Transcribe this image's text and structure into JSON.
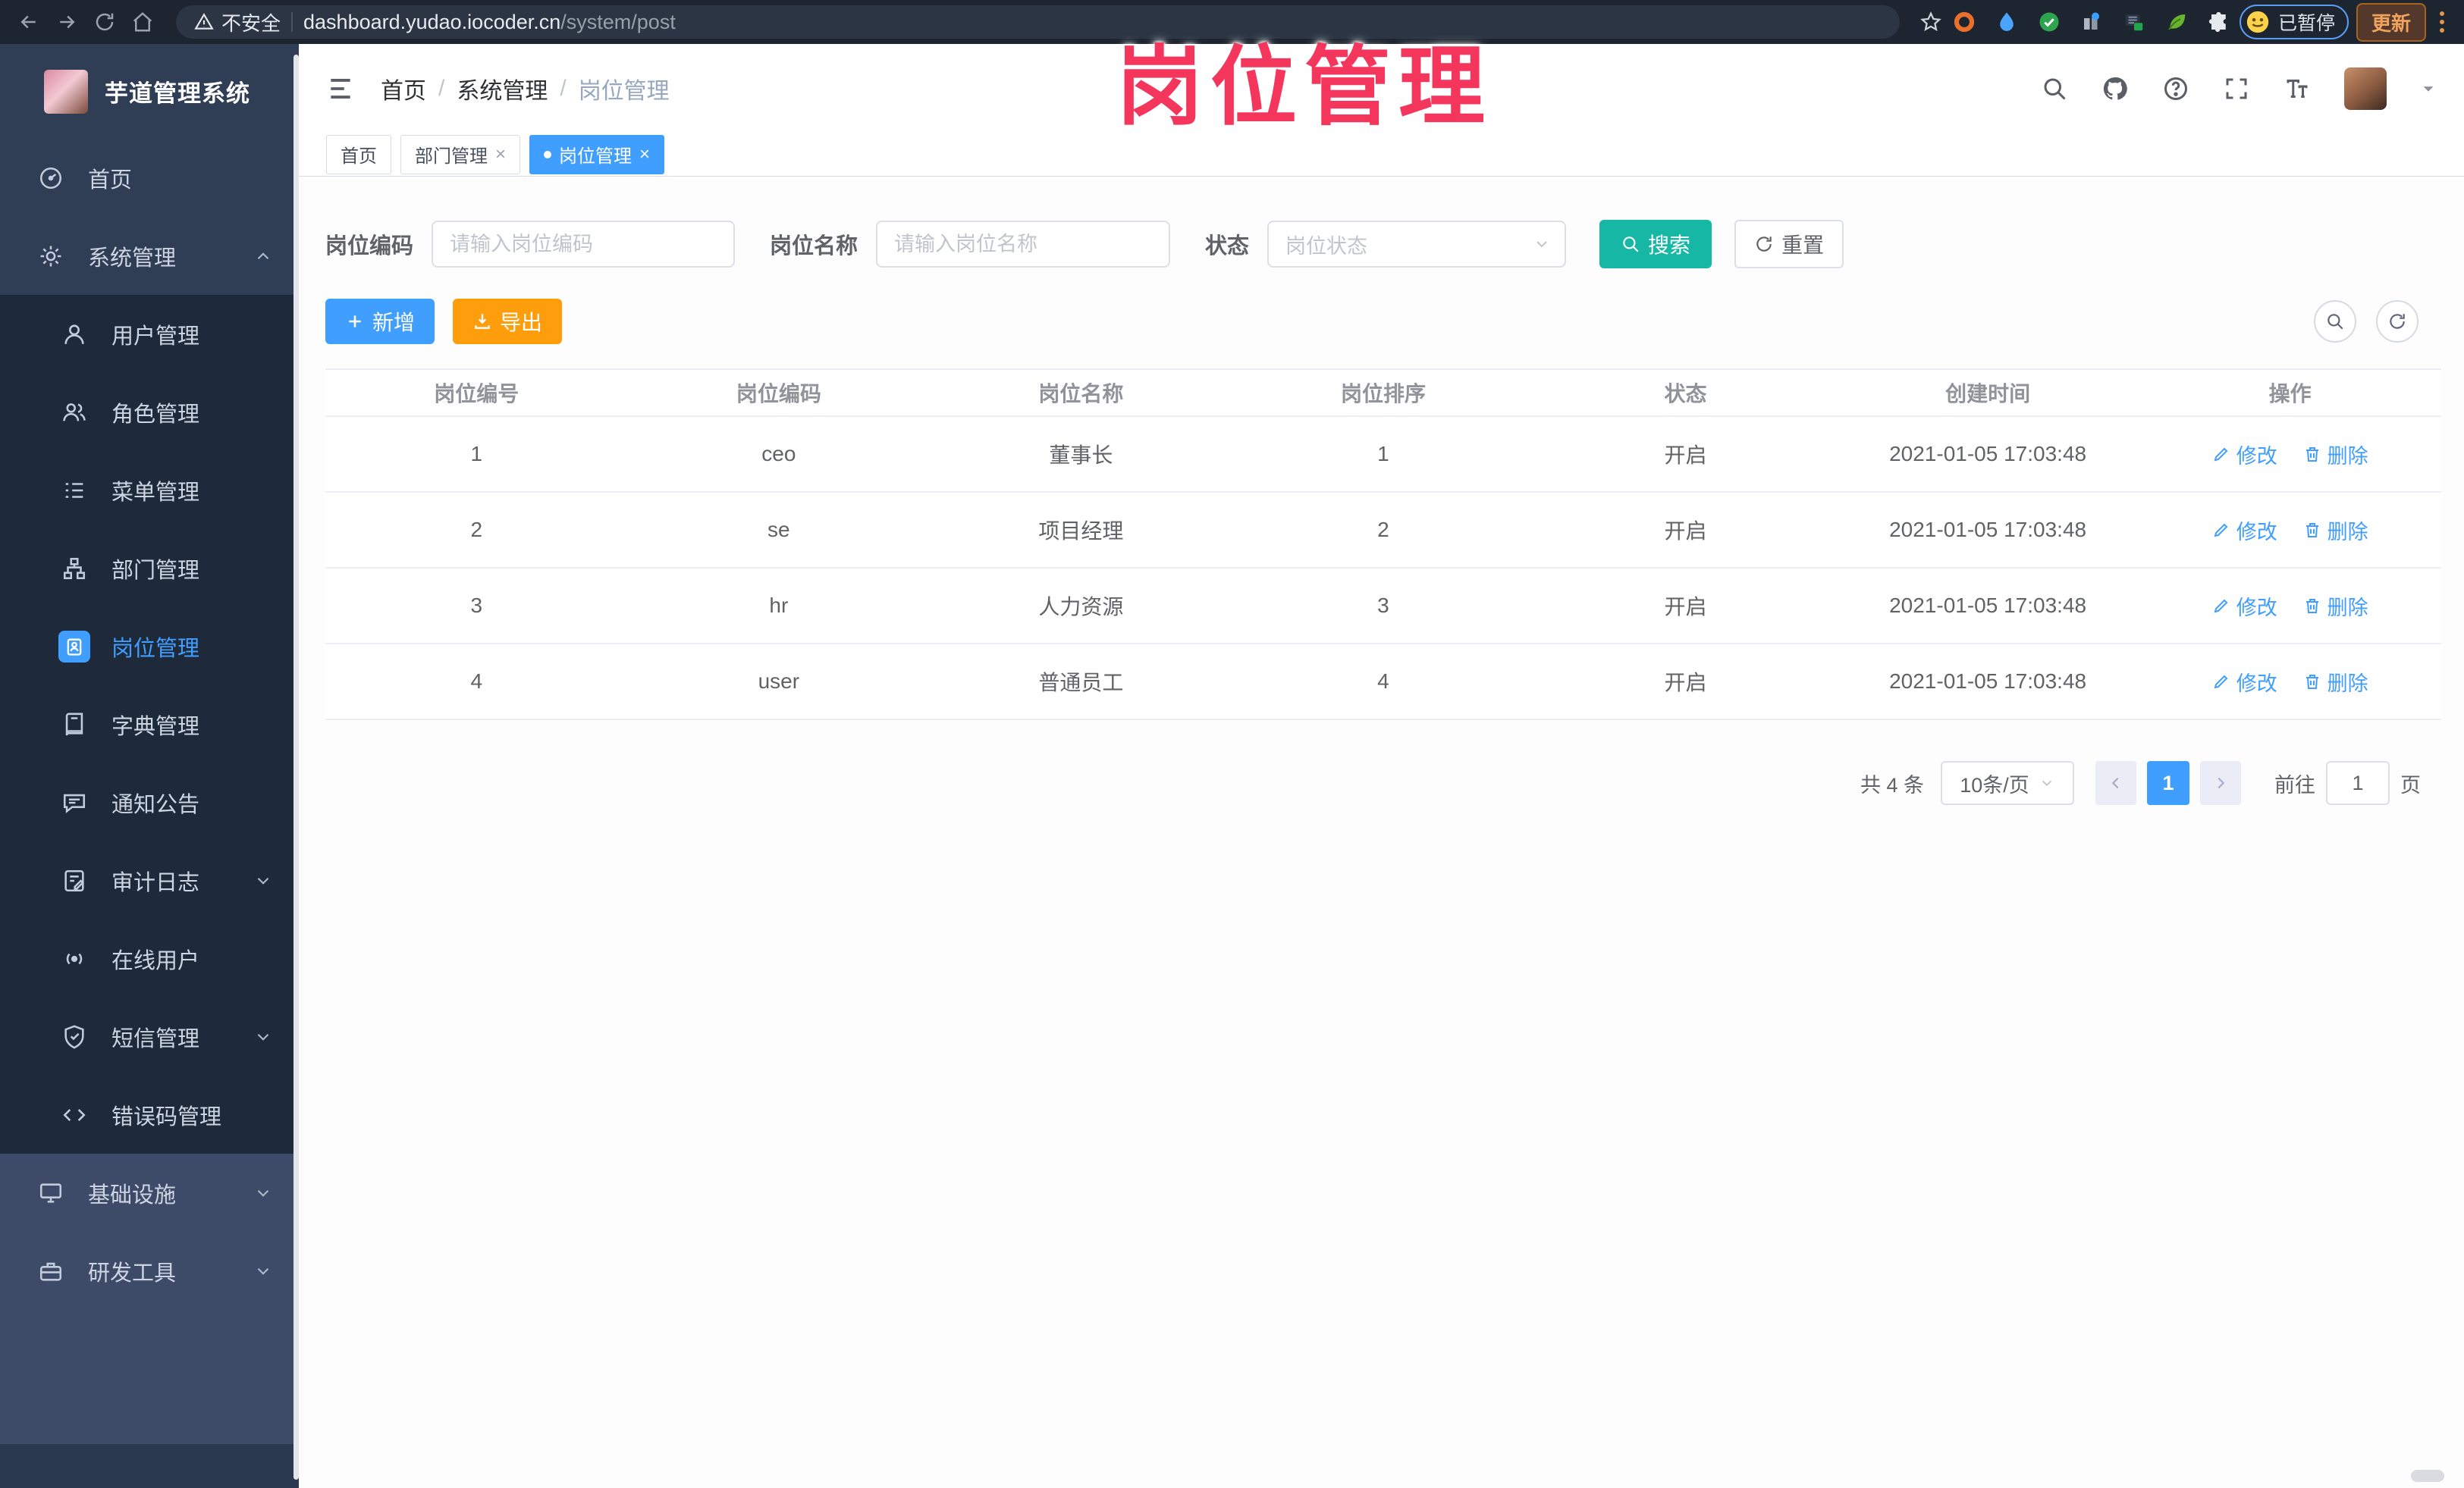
{
  "watermark": {
    "text": "岗位管理"
  },
  "browser": {
    "security_label": "不安全",
    "url_domain": "dashboard.yudao.iocoder.cn",
    "url_path": "/system/post",
    "paused_label": "已暂停",
    "update_label": "更新"
  },
  "sidebar": {
    "title": "芋道管理系统",
    "items": [
      {
        "label": "首页"
      },
      {
        "label": "系统管理"
      },
      {
        "label": "用户管理"
      },
      {
        "label": "角色管理"
      },
      {
        "label": "菜单管理"
      },
      {
        "label": "部门管理"
      },
      {
        "label": "岗位管理"
      },
      {
        "label": "字典管理"
      },
      {
        "label": "通知公告"
      },
      {
        "label": "审计日志"
      },
      {
        "label": "在线用户"
      },
      {
        "label": "短信管理"
      },
      {
        "label": "错误码管理"
      },
      {
        "label": "基础设施"
      },
      {
        "label": "研发工具"
      }
    ]
  },
  "header": {
    "breadcrumb": [
      "首页",
      "系统管理",
      "岗位管理"
    ],
    "separator": "/"
  },
  "tabs": [
    {
      "label": "首页"
    },
    {
      "label": "部门管理"
    },
    {
      "label": "岗位管理"
    }
  ],
  "filters": {
    "code_label": "岗位编码",
    "code_placeholder": "请输入岗位编码",
    "name_label": "岗位名称",
    "name_placeholder": "请输入岗位名称",
    "status_label": "状态",
    "status_placeholder": "岗位状态",
    "search_label": "搜索",
    "reset_label": "重置"
  },
  "toolbar": {
    "add_label": "新增",
    "export_label": "导出"
  },
  "table": {
    "columns": [
      "岗位编号",
      "岗位编码",
      "岗位名称",
      "岗位排序",
      "状态",
      "创建时间",
      "操作"
    ],
    "rows": [
      [
        "1",
        "ceo",
        "董事长",
        "1",
        "开启",
        "2021-01-05 17:03:48"
      ],
      [
        "2",
        "se",
        "项目经理",
        "2",
        "开启",
        "2021-01-05 17:03:48"
      ],
      [
        "3",
        "hr",
        "人力资源",
        "3",
        "开启",
        "2021-01-05 17:03:48"
      ],
      [
        "4",
        "user",
        "普通员工",
        "4",
        "开启",
        "2021-01-05 17:03:48"
      ]
    ],
    "edit_label": "修改",
    "delete_label": "删除"
  },
  "pagination": {
    "total_label": "共 4 条",
    "page_size_label": "10条/页",
    "current_page": "1",
    "goto_label": "前往",
    "goto_value": "1",
    "unit_label": "页"
  },
  "icons": [
    "back-icon",
    "forward-icon",
    "reload-icon",
    "home-icon",
    "warning-icon",
    "star-icon",
    "extension-icons",
    "emoji-icon",
    "hamburger-icon",
    "search-icon",
    "github-icon",
    "help-icon",
    "fullscreen-icon",
    "font-size-icon",
    "chevron-down-icon",
    "chevron-up-icon",
    "dashboard-icon",
    "gear-icon",
    "user-icon",
    "role-icon",
    "menu-icon",
    "dept-icon",
    "post-icon",
    "dict-icon",
    "announcement-icon",
    "audit-icon",
    "online-icon",
    "sms-icon",
    "code-icon",
    "infra-icon",
    "devtools-icon",
    "plus-icon",
    "download-icon",
    "refresh-icon",
    "edit-icon",
    "delete-icon",
    "close-icon"
  ],
  "colors": {
    "accent": "#409eff",
    "search_button": "#16b8a5",
    "export_button": "#ff9e0d",
    "watermark": "#f5365c",
    "sidebar_bg": "#2f3d55",
    "submenu_bg": "#1e2a3a"
  }
}
